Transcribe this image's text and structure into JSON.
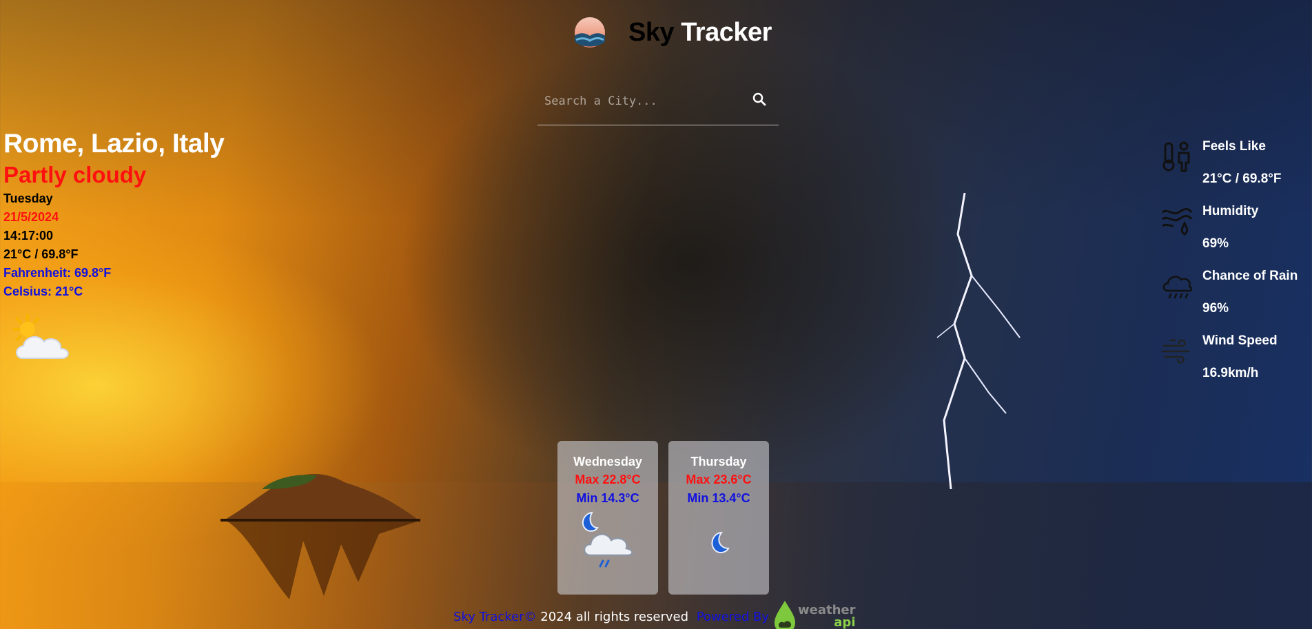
{
  "app": {
    "title_part1": "Sky",
    "title_part2": "Tracker"
  },
  "search": {
    "placeholder": "Search a City..."
  },
  "current": {
    "location": "Rome, Lazio, Italy",
    "condition": "Partly cloudy",
    "day": "Tuesday",
    "date": "21/5/2024",
    "time": "14:17:00",
    "temp": "21°C / 69.8°F",
    "fahrenheit": "Fahrenheit: 69.8°F",
    "celsius": "Celsius: 21°C",
    "icon": "partly-cloudy-sun-icon"
  },
  "stats": [
    {
      "label": "Feels Like",
      "value": "21°C / 69.8°F",
      "icon": "thermometer-person-icon"
    },
    {
      "label": "Humidity",
      "value": "69%",
      "icon": "humidity-icon"
    },
    {
      "label": "Chance of Rain",
      "value": "96%",
      "icon": "rain-cloud-icon"
    },
    {
      "label": "Wind Speed",
      "value": "16.9km/h",
      "icon": "wind-icon"
    }
  ],
  "forecast": [
    {
      "day": "Wednesday",
      "max": "Max 22.8°C",
      "min": "Min 14.3°C",
      "icon": "night-rain-icon"
    },
    {
      "day": "Thursday",
      "max": "Max 23.6°C",
      "min": "Min 13.4°C",
      "icon": "moon-icon"
    }
  ],
  "footer": {
    "brand": "Sky Tracker©",
    "rest": " 2024 all rights reserved ",
    "powered": "Powered By",
    "api_word1": "weather",
    "api_word2": "api"
  },
  "colors": {
    "accent_red": "#ff1010",
    "accent_blue": "#1010e0"
  }
}
